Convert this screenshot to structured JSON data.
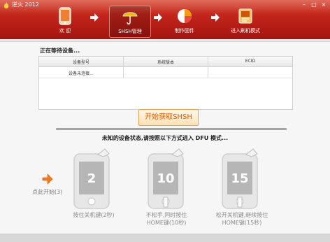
{
  "window": {
    "title": "逆火 2012"
  },
  "toolbar": {
    "items": [
      {
        "label": "欢 迎",
        "icon": "phone-welcome-icon"
      },
      {
        "label": "SHSH管理",
        "icon": "umbrella-icon",
        "active": true
      },
      {
        "label": "制作固件",
        "icon": "pie-chart-icon"
      },
      {
        "label": "进入刷机模式",
        "icon": "flash-mode-icon"
      }
    ]
  },
  "devices": {
    "heading": "正在等待设备...",
    "columns": [
      "设备型号",
      "系统版本",
      "ECID"
    ],
    "rows": [
      [
        "设备未连接...",
        "",
        ""
      ]
    ]
  },
  "actions": {
    "start_shsh": "开始获取SHSH"
  },
  "dfu": {
    "status": "未知的设备状态,请按照以下方式进入 DFU 模式...",
    "click_start": "点此开始(3)",
    "steps": [
      {
        "count": "2",
        "line1": "按住关机键(2秒)",
        "line2": ""
      },
      {
        "count": "10",
        "line1": "不松手,同时按住",
        "line2": "HOME键(10秒)"
      },
      {
        "count": "15",
        "line1": "松开关机键,继续按住",
        "line2": "HOME键(15秒)"
      }
    ]
  },
  "colors": {
    "titlebar": "#c0231a",
    "accent": "#e65a00",
    "button_border": "#e8a14c"
  }
}
